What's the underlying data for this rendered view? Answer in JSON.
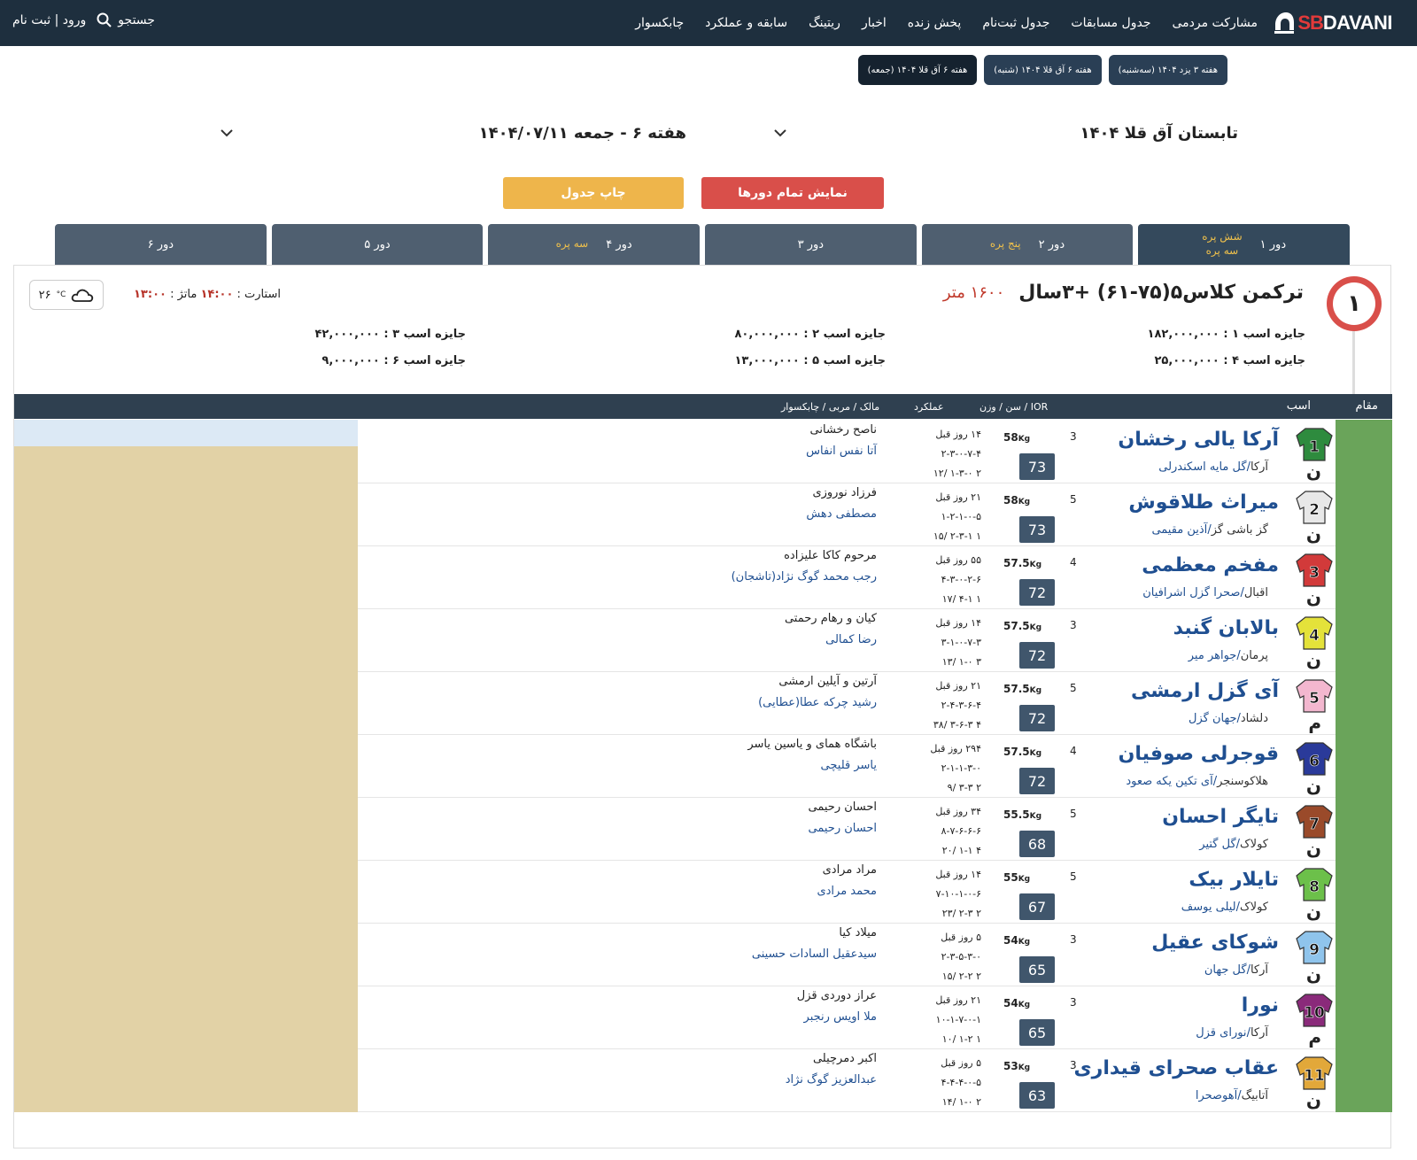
{
  "brand": {
    "logo_a": "SB",
    "logo_b": "DAVANI"
  },
  "nav": {
    "items": [
      "مشارکت مردمی",
      "جدول مسابقات",
      "جدول ثبت‌نام",
      "پخش زنده",
      "اخبار",
      "ریتینگ",
      "سابقه و عملکرد",
      "چابکسوار"
    ],
    "search": "جستجو",
    "login": "ورود | ثبت نام"
  },
  "weeks": [
    {
      "label": "هفته ۳ یزد ۱۴۰۴ (سه‌شنبه)",
      "active": false
    },
    {
      "label": "هفته ۶ آق قلا ۱۴۰۴ (شنبه)",
      "active": false
    },
    {
      "label": "هفته ۶ آق قلا ۱۴۰۴ (جمعه)",
      "active": true
    }
  ],
  "selectors": {
    "season": "تابستان آق قلا ۱۴۰۴",
    "meeting": "هفته ۶ - جمعه ۱۴۰۴/۰۷/۱۱"
  },
  "buttons": {
    "show_all": "نمایش تمام دورها",
    "print": "چاپ جدول"
  },
  "tabs": [
    {
      "label": "دور ۱",
      "sub1": "شش پره",
      "sub2": "سه پره",
      "active": true
    },
    {
      "label": "دور ۲",
      "sub1": "پنج پره",
      "sub2": "",
      "active": false
    },
    {
      "label": "دور ۳",
      "sub1": "",
      "sub2": "",
      "active": false
    },
    {
      "label": "دور ۴",
      "sub1": "سه پره",
      "sub2": "",
      "active": false
    },
    {
      "label": "دور ۵",
      "sub1": "",
      "sub2": "",
      "active": false
    },
    {
      "label": "دور ۶",
      "sub1": "",
      "sub2": "",
      "active": false
    }
  ],
  "race": {
    "number": "۱",
    "title": "ترکمن کلاس۵(۷۵-۶۱) +۳سال",
    "distance": "۱۶۰۰ متر",
    "start_label": "استارت :",
    "start_time": "۱۴:۰۰",
    "match_label": "ماتژ :",
    "match_time": "۱۳:۰۰",
    "temp": "۲۶",
    "temp_unit": "°C",
    "prizes": {
      "p1": "جایزه اسب ۱ : ۱۸۲,۰۰۰,۰۰۰",
      "p2": "جایزه اسب ۲ : ۸۰,۰۰۰,۰۰۰",
      "p3": "جایزه اسب ۳ : ۴۲,۰۰۰,۰۰۰",
      "p4": "جایزه اسب ۴ : ۲۵,۰۰۰,۰۰۰",
      "p5": "جایزه اسب ۵ : ۱۳,۰۰۰,۰۰۰",
      "p6": "جایزه اسب ۶ : ۹,۰۰۰,۰۰۰"
    }
  },
  "table": {
    "headers": {
      "place": "مقام",
      "horse": "اسب",
      "age_w_ior": "سن / وزن / IOR",
      "perf": "عملکرد",
      "owner": "مالک / مربی / چابکسوار"
    },
    "rows": [
      {
        "num": "1",
        "color": "#2e8b3e",
        "sex": "ن",
        "name": "آرکا یالی رخشان",
        "sire": "آرکا",
        "dam": "گل مایه اسکندرلی",
        "age": "3",
        "weight": "58",
        "ior": "73",
        "days": "۱۴ روز قبل",
        "form": "۲-۳-۰-۷-۴",
        "last": "۲ ۱-۳-۰ /۱۲",
        "owner": "ناصح رخشانی",
        "trainer": "آتا نفس انفاس"
      },
      {
        "num": "2",
        "color": "#e8e8e8",
        "sex": "ن",
        "name": "میراث طلاقوش",
        "sire": "گز باشی گز",
        "dam": "آذین مقیمی",
        "age": "5",
        "weight": "58",
        "ior": "73",
        "days": "۲۱ روز قبل",
        "form": "۱-۲-۱-۰-۵",
        "last": "۱ ۲-۳-۱ /۱۵",
        "owner": "فرزاد نوروزی",
        "trainer": "مصطفی دهش"
      },
      {
        "num": "3",
        "color": "#d23a3a",
        "sex": "ن",
        "name": "مفخم معظمی",
        "sire": "اقبال",
        "dam": "صحرا گزل اشرافیان",
        "age": "4",
        "weight": "57.5",
        "ior": "72",
        "days": "۵۵ روز قبل",
        "form": "۴-۳-۰-۲-۶",
        "last": "۱ ۴-۱ /۱۷",
        "owner": "مرحوم کاکا علیزاده",
        "trainer": "رجب محمد گوگ نژاد(تاشجان)"
      },
      {
        "num": "4",
        "color": "#e4e23a",
        "sex": "ن",
        "name": "بالابان گنبد",
        "sire": "پرمان",
        "dam": "جواهر میر",
        "age": "3",
        "weight": "57.5",
        "ior": "72",
        "days": "۱۴ روز قبل",
        "form": "۳-۱-۰-۷-۳",
        "last": "۳ ۱-۰ /۱۳",
        "owner": "کیان و رهام رحمتی",
        "trainer": "رضا کمالی"
      },
      {
        "num": "5",
        "color": "#f3b7cf",
        "sex": "م",
        "name": "آی گزل ارمشی",
        "sire": "دلشاد",
        "dam": "جهان گزل",
        "age": "5",
        "weight": "57.5",
        "ior": "72",
        "days": "۲۱ روز قبل",
        "form": "۲-۴-۳-۶-۴",
        "last": "۴ ۳-۶-۳ /۳۸",
        "owner": "آرتین و آیلین ارمشی",
        "trainer": "رشید چرکه عطا(عطایی)"
      },
      {
        "num": "6",
        "color": "#2a3a9a",
        "sex": "ن",
        "name": "قوجرلی صوفیان",
        "sire": "هلاکوسنجر",
        "dam": "آی تکین یکه صعود",
        "age": "4",
        "weight": "57.5",
        "ior": "72",
        "days": "۲۹۴ روز قبل",
        "form": "۲-۱-۱-۳-۰",
        "last": "۲ ۳-۳ /۹",
        "owner": "باشگاه همای و یاسین یاسر",
        "trainer": "یاسر قلیچی"
      },
      {
        "num": "7",
        "color": "#9a4a2a",
        "sex": "ن",
        "name": "تایگر احسان",
        "sire": "کولاک",
        "dam": "گل گتیر",
        "age": "5",
        "weight": "55.5",
        "ior": "68",
        "days": "۳۴ روز قبل",
        "form": "۸-۷-۶-۶-۶",
        "last": "۴ ۱-۱ /۲۰",
        "owner": "احسان رحیمی",
        "trainer": "احسان رحیمی"
      },
      {
        "num": "8",
        "color": "#6cc04a",
        "sex": "ن",
        "name": "تایلار بیک",
        "sire": "کولاک",
        "dam": "لیلی یوسف",
        "age": "5",
        "weight": "55",
        "ior": "67",
        "days": "۱۴ روز قبل",
        "form": "۷-۱۰-۱-۰-۶",
        "last": "۲ ۲-۳ /۲۳",
        "owner": "مراد مرادی",
        "trainer": "محمد مرادی"
      },
      {
        "num": "9",
        "color": "#8fc4ec",
        "sex": "ن",
        "name": "شوکای عقیل",
        "sire": "آرکا",
        "dam": "گل جهان",
        "age": "3",
        "weight": "54",
        "ior": "65",
        "days": "۵ روز قبل",
        "form": "۲-۳-۵-۳-۰",
        "last": "۲ ۲-۲ /۱۵",
        "owner": "میلاد کیا",
        "trainer": "سیدعقیل السادات حسینی"
      },
      {
        "num": "10",
        "color": "#8a2a7a",
        "sex": "م",
        "name": "نورا",
        "sire": "آرکا",
        "dam": "نورای قزل",
        "age": "3",
        "weight": "54",
        "ior": "65",
        "days": "۲۱ روز قبل",
        "form": "۱۰-۱-۷-۰-۱",
        "last": "۱ ۱-۲ /۱۰",
        "owner": "عراز دوردی قزل",
        "trainer": "ملا اویس رنجبر"
      },
      {
        "num": "11",
        "color": "#e2a83a",
        "sex": "ن",
        "name": "عقاب صحرای قیداری",
        "sire": "آتابیگ",
        "dam": "آهوصحرا",
        "age": "3",
        "weight": "53",
        "ior": "63",
        "days": "۵ روز قبل",
        "form": "۴-۴-۴-۰-۵",
        "last": "۲ ۱-۰ /۱۴",
        "owner": "اکبر دمرچیلی",
        "trainer": "عبدالعزیز گوگ نژاد"
      }
    ]
  }
}
